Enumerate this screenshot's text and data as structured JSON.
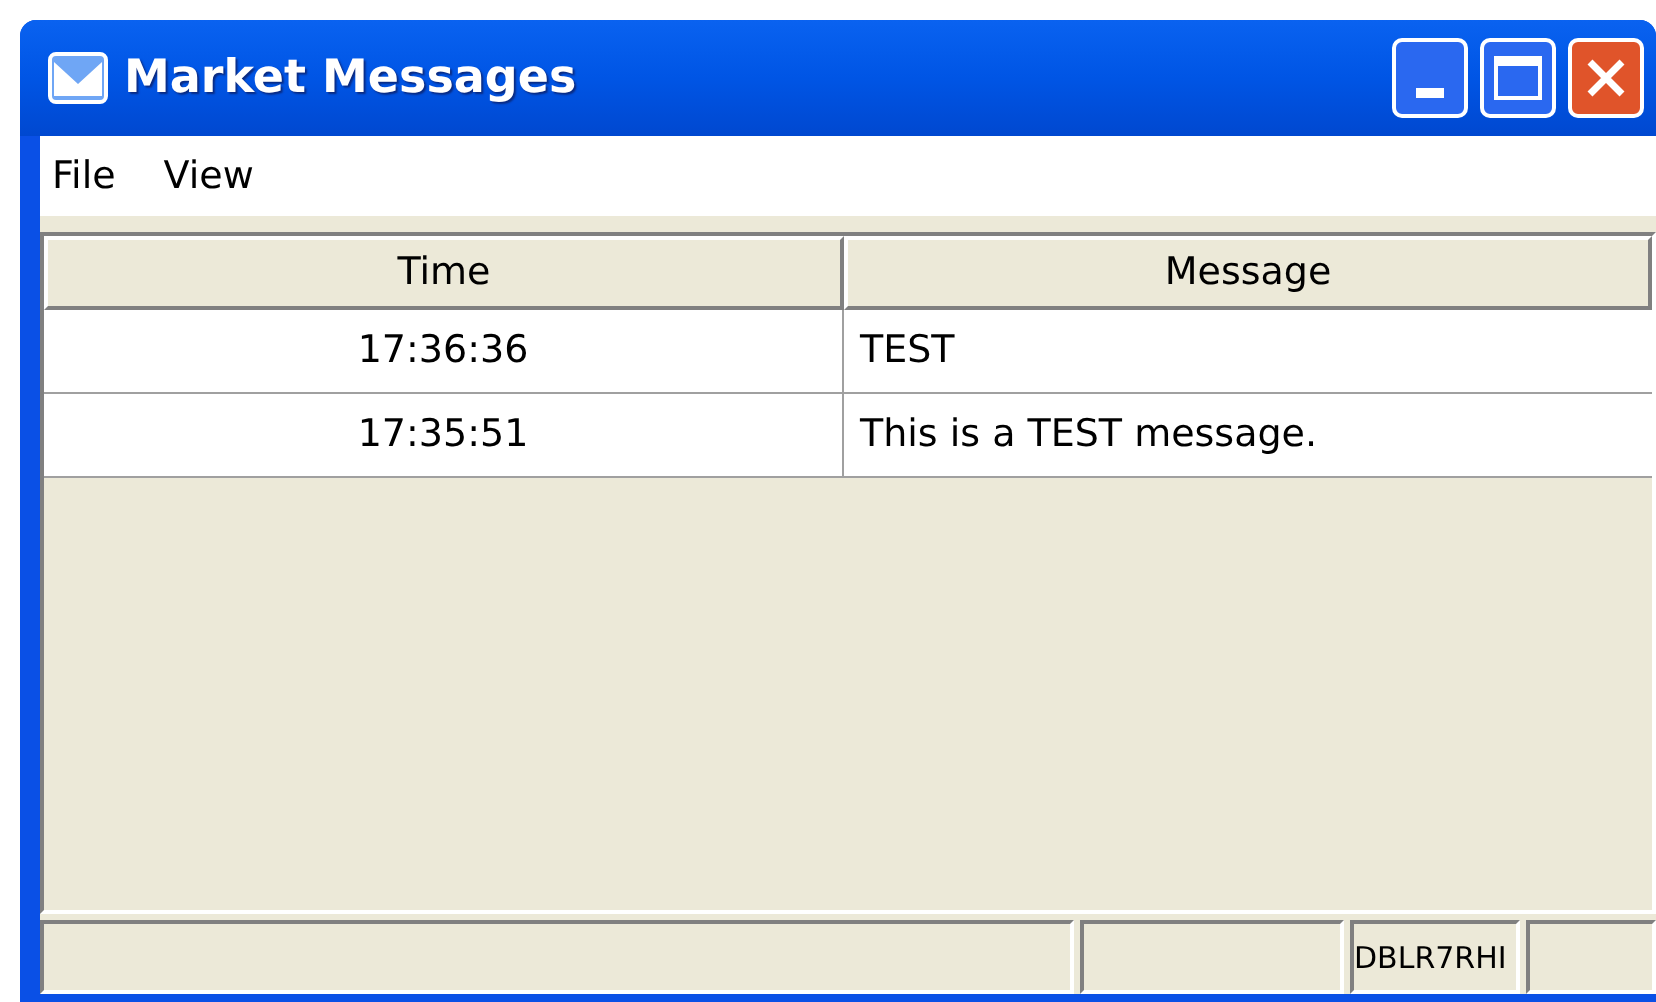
{
  "window": {
    "title": "Market Messages"
  },
  "menu": [
    {
      "label": "File"
    },
    {
      "label": "View"
    }
  ],
  "table": {
    "columns": [
      "Time",
      "Message"
    ],
    "rows": [
      [
        "17:36:36",
        "TEST"
      ],
      [
        "17:35:51",
        "This is a TEST message."
      ]
    ]
  },
  "status_bar": {
    "pane_3": "DBLR7RHI"
  }
}
